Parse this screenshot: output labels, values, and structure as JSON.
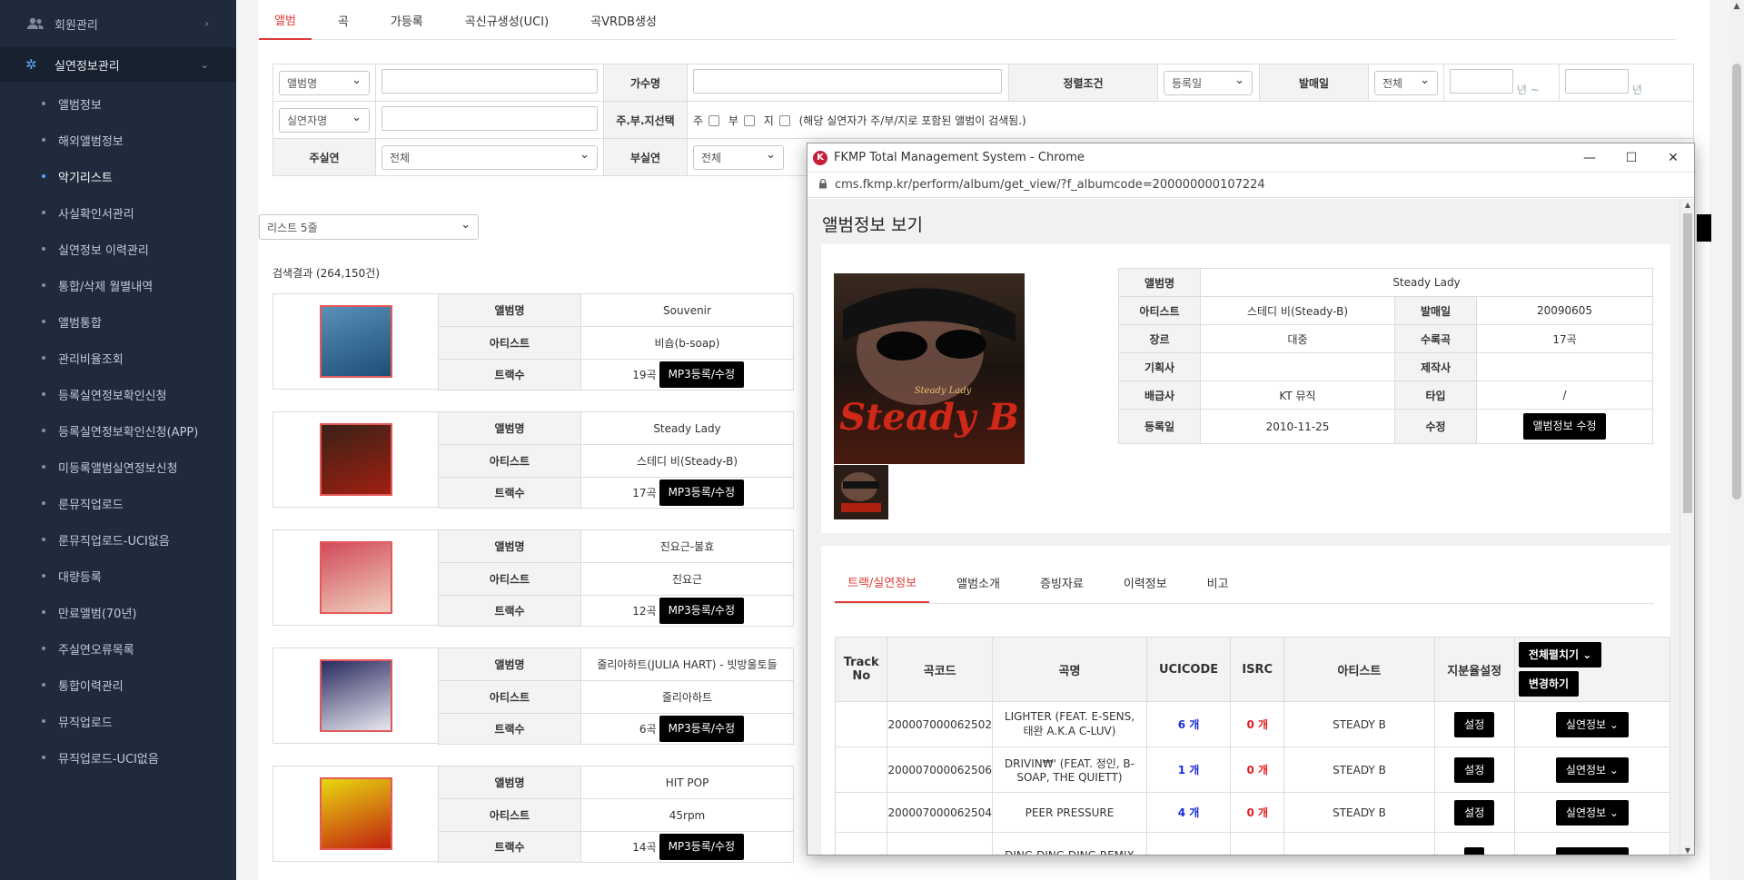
{
  "sidebar": {
    "top_item": "회원관리",
    "section": "실연정보관리",
    "items": [
      {
        "label": "앨범정보"
      },
      {
        "label": "해외앨범정보"
      },
      {
        "label": "악기리스트",
        "active": true
      },
      {
        "label": "사실확인서관리"
      },
      {
        "label": "실연정보 이력관리"
      },
      {
        "label": "통합/삭제 월별내역"
      },
      {
        "label": "앨범통합"
      },
      {
        "label": "관리비율조회"
      },
      {
        "label": "등록실연정보확인신청"
      },
      {
        "label": "등록실연정보확인신청(APP)"
      },
      {
        "label": "미등록앨범실연정보신청"
      },
      {
        "label": "룬뮤직업로드"
      },
      {
        "label": "룬뮤직업로드-UCI없음"
      },
      {
        "label": "대량등록"
      },
      {
        "label": "만료앨범(70년)"
      },
      {
        "label": "주실연오류목록"
      },
      {
        "label": "통합이력관리"
      },
      {
        "label": "뮤직업로드"
      },
      {
        "label": "뮤직업로드-UCI없음"
      }
    ]
  },
  "tabs": [
    "앨범",
    "곡",
    "가등록",
    "곡신규생성(UCI)",
    "곡VRDB생성"
  ],
  "search": {
    "album_select": "앨범명",
    "singer_label": "가수명",
    "sort_label": "정렬조건",
    "sort_select": "등록일",
    "release_label": "발매일",
    "release_select": "전체",
    "year_from_suffix": "년 ~",
    "year_to_suffix": "년",
    "performer_select": "실연자명",
    "role_label": "주.부.지선택",
    "role_main": "주",
    "role_sub": "부",
    "role_ji": "지",
    "role_note": "(해당 실연자가 주/부/지로 포함된 앨범이 검색됨.)",
    "main_perf_label": "주실연",
    "main_perf_select": "전체",
    "sub_perf_label": "부실연",
    "sub_perf_select": "전체"
  },
  "list_select": "리스트 5줄",
  "result_count": "검색결과 (264,150건)",
  "labels": {
    "album": "앨범명",
    "artist": "아티스트",
    "tracks": "트랙수",
    "mp3_button": "MP3등록/수정"
  },
  "albums": [
    {
      "title": "Souvenir",
      "artist": "비숍(b-soap)",
      "tracks": "19곡"
    },
    {
      "title": "Steady Lady",
      "artist": "스테디 비(Steady-B)",
      "tracks": "17곡"
    },
    {
      "title": "진요근-불효",
      "artist": "진요근",
      "tracks": "12곡"
    },
    {
      "title": "줄리아하트(JULIA HART) - 빗방울토들",
      "artist": "줄리아하트",
      "tracks": "6곡"
    },
    {
      "title": "HIT POP",
      "artist": "45rpm",
      "tracks": "14곡"
    }
  ],
  "popup": {
    "window_title": "FKMP Total Management System - Chrome",
    "url": "cms.fkmp.kr/perform/album/get_view/?f_albumcode=200000000107224",
    "heading": "앨범정보 보기",
    "cover_text": "Steady B",
    "cover_sub": "Steady Lady",
    "info": {
      "album_label": "앨범명",
      "album": "Steady Lady",
      "artist_label": "아티스트",
      "artist": "스테디 비(Steady-B)",
      "release_label": "발매일",
      "release": "20090605",
      "genre_label": "장르",
      "genre": "대중",
      "tracks_label": "수록곡",
      "tracks": "17곡",
      "planner_label": "기획사",
      "planner": "",
      "producer_label": "제작사",
      "producer": "",
      "distributor_label": "배급사",
      "distributor": "KT 뮤직",
      "type_label": "타입",
      "type": "/",
      "reg_label": "등록일",
      "reg": "2010-11-25",
      "edit_label": "수정",
      "edit_button": "앨범정보 수정"
    },
    "tabs": [
      "트랙/실연정보",
      "앨범소개",
      "증빙자료",
      "이력정보",
      "비고"
    ],
    "table_headers": {
      "track_no": "Track No",
      "song_code": "곡코드",
      "song_name": "곡명",
      "uci": "UCICODE",
      "isrc": "ISRC",
      "artist": "아티스트",
      "share": "지분율설정",
      "expand_all": "전체펼치기 ⌄",
      "change": "변경하기"
    },
    "tracks": [
      {
        "no": "",
        "code": "200007000062502",
        "name": "LIGHTER (FEAT. E-SENS, 태완 A.K.A C-LUV)",
        "uci": "6 개",
        "isrc": "0 개",
        "artist": "STEADY B"
      },
      {
        "no": "",
        "code": "200007000062506",
        "name": "DRIVIN₩' (FEAT. 정인, B-SOAP, THE QUIETT)",
        "uci": "1 개",
        "isrc": "0 개",
        "artist": "STEADY B"
      },
      {
        "no": "",
        "code": "200007000062504",
        "name": "PEER PRESSURE",
        "uci": "4 개",
        "isrc": "0 개",
        "artist": "STEADY B"
      },
      {
        "no": "",
        "code": "",
        "name": "DING DING DING REMIX",
        "uci": "",
        "isrc": "",
        "artist": ""
      }
    ],
    "setting_button": "설정",
    "perf_button": "실연정보 ⌄"
  },
  "colors": {
    "sidebar_bg": "#1f2a3c",
    "accent_red": "#e23a3a",
    "blue_count": "#1a2ed8"
  }
}
